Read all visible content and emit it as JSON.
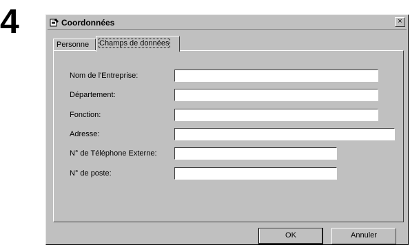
{
  "step_number": "4",
  "window": {
    "title": "Coordonnées",
    "close_glyph": "×"
  },
  "tabs": [
    {
      "label": "Personne",
      "active": false
    },
    {
      "label": "Champs de données",
      "active": true
    }
  ],
  "fields": [
    {
      "label": "Nom de l'Entreprise:",
      "value": ""
    },
    {
      "label": "Département:",
      "value": ""
    },
    {
      "label": "Fonction:",
      "value": ""
    },
    {
      "label": "Adresse:",
      "value": ""
    },
    {
      "label": "N° de Téléphone Externe:",
      "value": ""
    },
    {
      "label": "N° de poste:",
      "value": ""
    }
  ],
  "buttons": {
    "ok": "OK",
    "cancel": "Annuler"
  },
  "icons": {
    "app": "phonebook-icon",
    "close": "close-icon"
  }
}
